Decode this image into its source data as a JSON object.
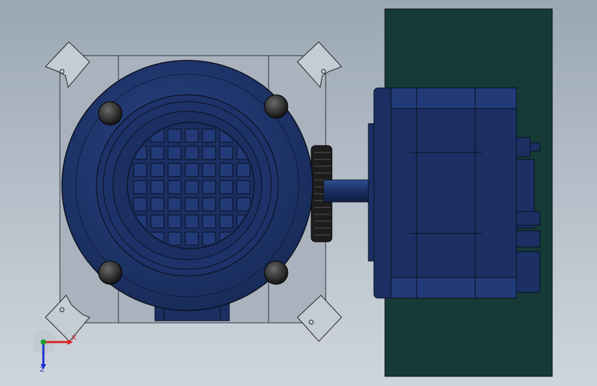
{
  "viewport": {
    "background_top": "#9aa7b4",
    "background_bottom": "#cfd5dc"
  },
  "model": {
    "motor_color": "#1b2f63",
    "motor_highlight": "#2a4585",
    "panel_color": "#163a36",
    "outline_color": "#0a0f1c"
  },
  "triad": {
    "x_label": "X",
    "z_label": "Z",
    "x_color": "#e02020",
    "z_color": "#1a2fd0",
    "y_color": "#20a030"
  }
}
